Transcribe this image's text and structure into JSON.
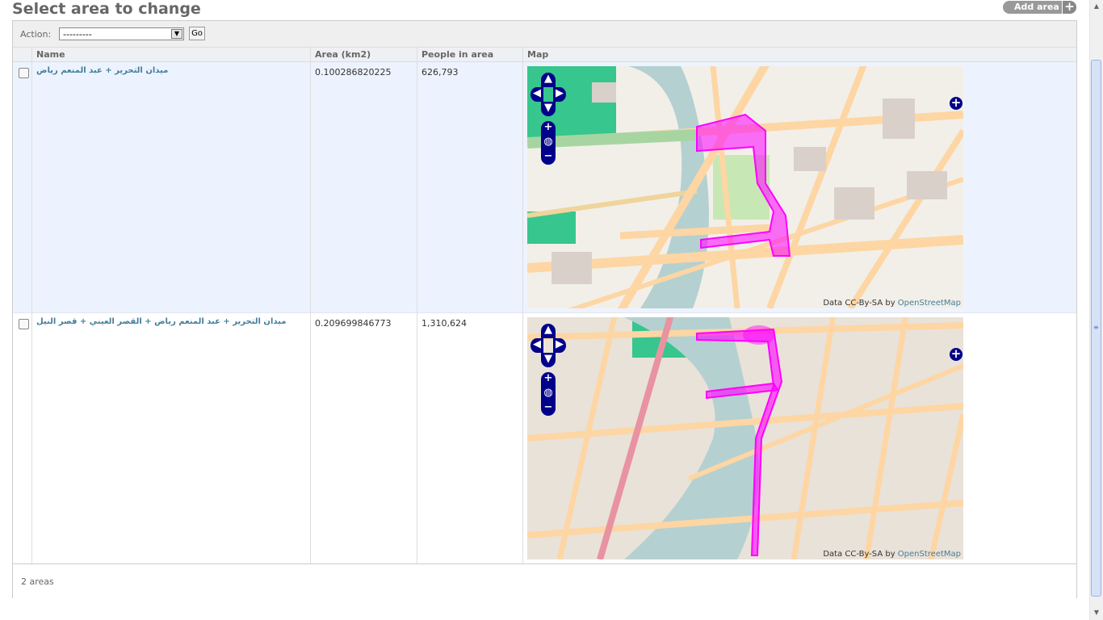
{
  "page": {
    "title": "Select area to change"
  },
  "tools": {
    "add_label": "Add area",
    "add_plus": "+"
  },
  "actions": {
    "label": "Action:",
    "selected": "---------",
    "go_label": "Go"
  },
  "table": {
    "headers": [
      "Name",
      "Area (km2)",
      "People in area",
      "Map"
    ],
    "rows": [
      {
        "name": "ميدان التحرير + عبد المنعم رياض",
        "area": "0.100286820225",
        "people": "626,793"
      },
      {
        "name": "ميدان التحرير + عبد المنعم رياض + القصر العيني + قصر النيل",
        "area": "0.209699846773",
        "people": "1,310,624"
      }
    ]
  },
  "map": {
    "attribution_prefix": "Data CC-By-SA by ",
    "attribution_link": "OpenStreetMap",
    "zoom_in": "+",
    "zoom_out": "−",
    "layer_switch": "+",
    "icons": [
      "pan-up-icon",
      "pan-down-icon",
      "pan-left-icon",
      "pan-right-icon",
      "zoom-world-icon"
    ]
  },
  "footer": {
    "count": "2 areas"
  },
  "colors": {
    "accent": "#447e9b",
    "map_control": "#00008b",
    "polygon": "#ff00ff",
    "water": "#b5d0d0",
    "road": "#fdd6a4",
    "park": "#36c68e"
  }
}
